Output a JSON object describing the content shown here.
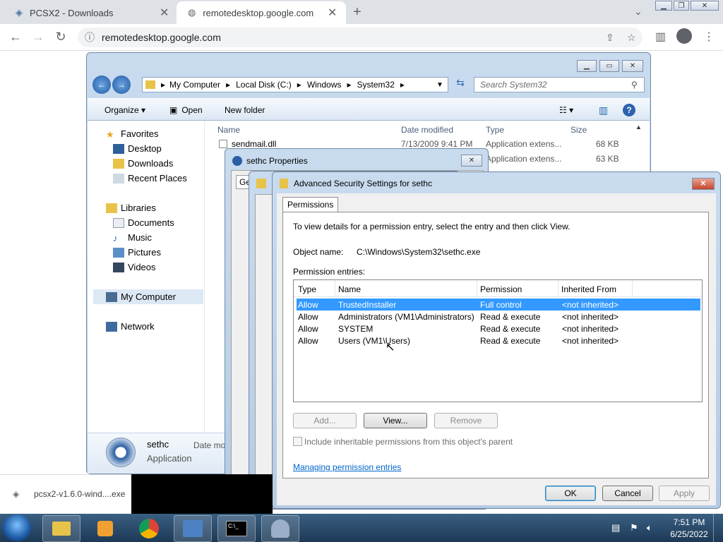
{
  "browser": {
    "tabs": [
      {
        "title": "PCSX2 - Downloads"
      },
      {
        "title": "remotedesktop.google.com"
      }
    ],
    "url": "remotedesktop.google.com",
    "download": {
      "filename": "pcsx2-v1.6.0-wind....exe"
    }
  },
  "explorer": {
    "breadcrumb": [
      "My Computer",
      "Local Disk (C:)",
      "Windows",
      "System32"
    ],
    "search_placeholder": "Search System32",
    "toolbar": {
      "organize": "Organize",
      "open": "Open",
      "new_folder": "New folder"
    },
    "sidebar": {
      "favorites": {
        "label": "Favorites",
        "items": [
          "Desktop",
          "Downloads",
          "Recent Places"
        ]
      },
      "libraries": {
        "label": "Libraries",
        "items": [
          "Documents",
          "Music",
          "Pictures",
          "Videos"
        ]
      },
      "computer": "My Computer",
      "network": "Network"
    },
    "columns": [
      "Name",
      "Date modified",
      "Type",
      "Size"
    ],
    "files": [
      {
        "name": "sendmail.dll",
        "date": "7/13/2009 9:41 PM",
        "type": "Application extens...",
        "size": "68 KB"
      },
      {
        "name": "",
        "date": "",
        "type": "Application extens...",
        "size": "63 KB"
      }
    ],
    "details": {
      "name": "sethc",
      "kind": "Application",
      "date_label": "Date mo"
    }
  },
  "sethc_properties": {
    "title": "sethc Properties",
    "tab_fragment": "Ge"
  },
  "advanced_security": {
    "title": "Advanced Security Settings for sethc",
    "tab": "Permissions",
    "instructions": "To view details for a permission entry, select the entry and then click View.",
    "object_label": "Object name:",
    "object_value": "C:\\Windows\\System32\\sethc.exe",
    "entries_label": "Permission entries:",
    "columns": [
      "Type",
      "Name",
      "Permission",
      "Inherited From"
    ],
    "entries": [
      {
        "type": "Allow",
        "name": "TrustedInstaller",
        "permission": "Full control",
        "inherited": "<not inherited>"
      },
      {
        "type": "Allow",
        "name": "Administrators (VM1\\Administrators)",
        "permission": "Read & execute",
        "inherited": "<not inherited>"
      },
      {
        "type": "Allow",
        "name": "SYSTEM",
        "permission": "Read & execute",
        "inherited": "<not inherited>"
      },
      {
        "type": "Allow",
        "name": "Users (VM1\\Users)",
        "permission": "Read & execute",
        "inherited": "<not inherited>"
      }
    ],
    "buttons": {
      "add": "Add...",
      "view": "View...",
      "remove": "Remove"
    },
    "include_inheritable": "Include inheritable permissions from this object's parent",
    "link": "Managing permission entries",
    "footer": {
      "ok": "OK",
      "cancel": "Cancel",
      "apply": "Apply"
    }
  },
  "taskbar": {
    "time": "7:51 PM",
    "date": "6/25/2022"
  },
  "colors": {
    "selection": "#3399ff",
    "link": "#0066cc",
    "taskbar": "#2a4a6b"
  }
}
